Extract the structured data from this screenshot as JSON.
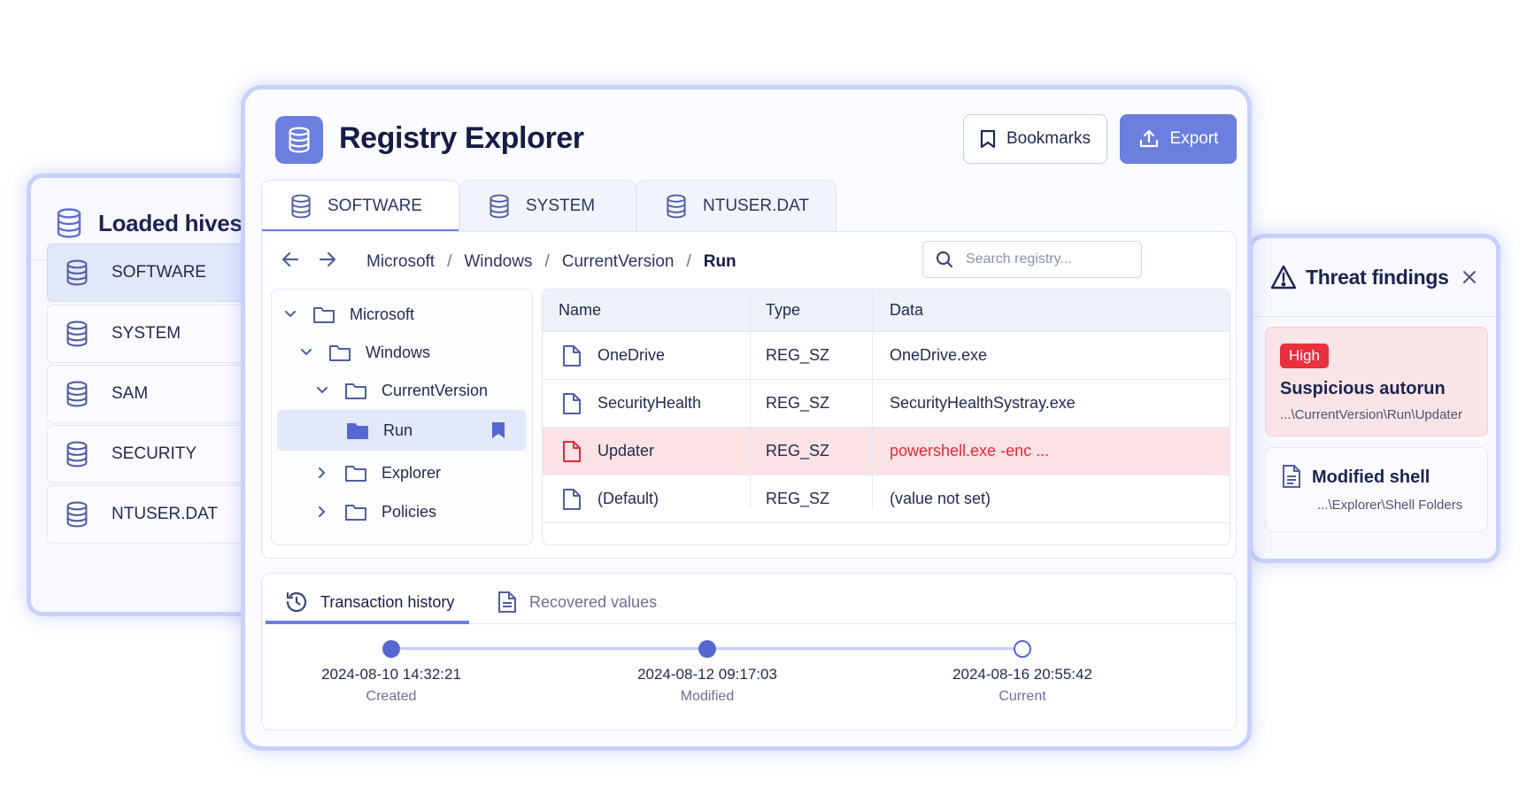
{
  "app": {
    "title": "Registry Explorer",
    "bookmarks_label": "Bookmarks",
    "export_label": "Export",
    "accent": "#6b7fde"
  },
  "hives_panel": {
    "title": "Loaded hives",
    "items": [
      "SOFTWARE",
      "SYSTEM",
      "SAM",
      "SECURITY",
      "NTUSER.DAT"
    ],
    "selected": "SOFTWARE"
  },
  "tabs": [
    "SOFTWARE",
    "SYSTEM",
    "NTUSER.DAT"
  ],
  "breadcrumb": [
    "Microsoft",
    "Windows",
    "CurrentVersion",
    "Run"
  ],
  "search": {
    "placeholder": "Search registry..."
  },
  "tree": [
    "Microsoft",
    "Windows",
    "CurrentVersion",
    "Run",
    "Explorer",
    "Policies"
  ],
  "table": {
    "columns": [
      "Name",
      "Type",
      "Data"
    ],
    "rows": [
      {
        "name": "OneDrive",
        "type": "REG_SZ",
        "data": "OneDrive.exe"
      },
      {
        "name": "SecurityHealth",
        "type": "REG_SZ",
        "data": "SecurityHealthSystray.exe"
      },
      {
        "name": "Updater",
        "type": "REG_SZ",
        "data": "powershell.exe -enc ..."
      },
      {
        "name": "(Default)",
        "type": "REG_SZ",
        "data": "(value not set)"
      }
    ],
    "alert_color": "#e02a38"
  },
  "history": {
    "tabs": [
      "Transaction history",
      "Recovered values"
    ],
    "events": [
      {
        "date": "2024-08-10 14:32:21",
        "label": "Created"
      },
      {
        "date": "2024-08-12 09:17:03",
        "label": "Modified"
      },
      {
        "date": "2024-08-16 20:55:42",
        "label": "Current"
      }
    ]
  },
  "threats": {
    "title": "Threat findings",
    "findings": [
      {
        "severity": "High",
        "title": "Suspicious autorun",
        "path": "...\\CurrentVersion\\Run\\Updater"
      },
      {
        "title": "Modified shell",
        "path": "...\\Explorer\\Shell Folders"
      }
    ],
    "high_color": "#e8303f"
  }
}
